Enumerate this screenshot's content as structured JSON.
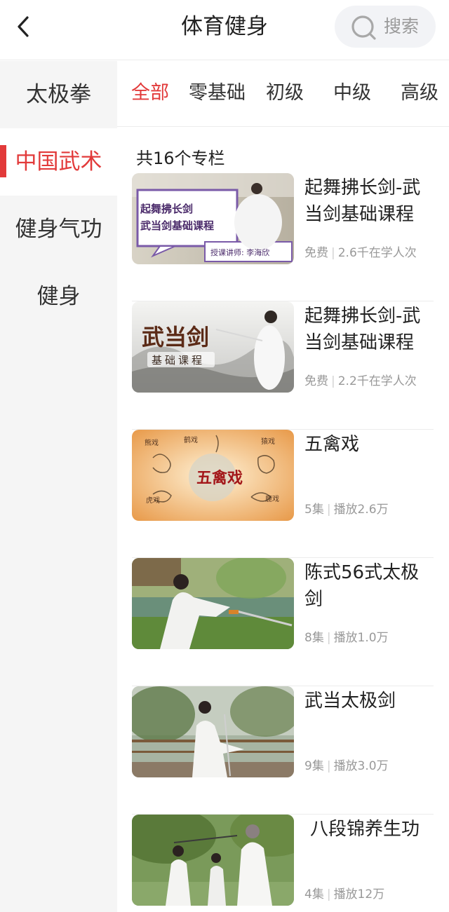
{
  "header": {
    "title": "体育健身",
    "search_label": "搜索"
  },
  "sidebar": {
    "items": [
      {
        "label": "太极拳"
      },
      {
        "label": "中国武术"
      },
      {
        "label": "健身气功"
      },
      {
        "label": "健身"
      }
    ],
    "active_index": 1
  },
  "tabs": [
    {
      "label": "全部"
    },
    {
      "label": "零基础"
    },
    {
      "label": "初级"
    },
    {
      "label": "中级"
    },
    {
      "label": "高级"
    }
  ],
  "active_tab_index": 0,
  "colors": {
    "accent": "#e23a3a",
    "muted": "#999999"
  },
  "content": {
    "count_text": "共16个专栏",
    "items": [
      {
        "title": "起舞拂长剑-武当剑基础课程",
        "meta1": "免费",
        "meta2": "2.6千在学人次",
        "thumb": {
          "line1": "起舞拂长剑",
          "line2": "武当剑基础课程",
          "teacher": "授课讲师: 李海欣"
        }
      },
      {
        "title": "起舞拂长剑-武当剑基础课程",
        "meta1": "免费",
        "meta2": "2.2千在学人次",
        "thumb": {
          "big": "武当剑",
          "small": "基础课程"
        }
      },
      {
        "title": "五禽戏",
        "meta1": "5集",
        "meta2": "播放2.6万",
        "thumb": {
          "center": "五禽戏",
          "labels": [
            "熊戏",
            "鹤戏",
            "猿戏",
            "虎戏",
            "鹿戏"
          ]
        }
      },
      {
        "title": "陈式56式太极剑",
        "meta1": "8集",
        "meta2": "播放1.0万"
      },
      {
        "title": "武当太极剑",
        "meta1": "9集",
        "meta2": "播放3.0万"
      },
      {
        "title": "八段锦养生功",
        "meta1": "4集",
        "meta2": "播放12万"
      }
    ]
  }
}
